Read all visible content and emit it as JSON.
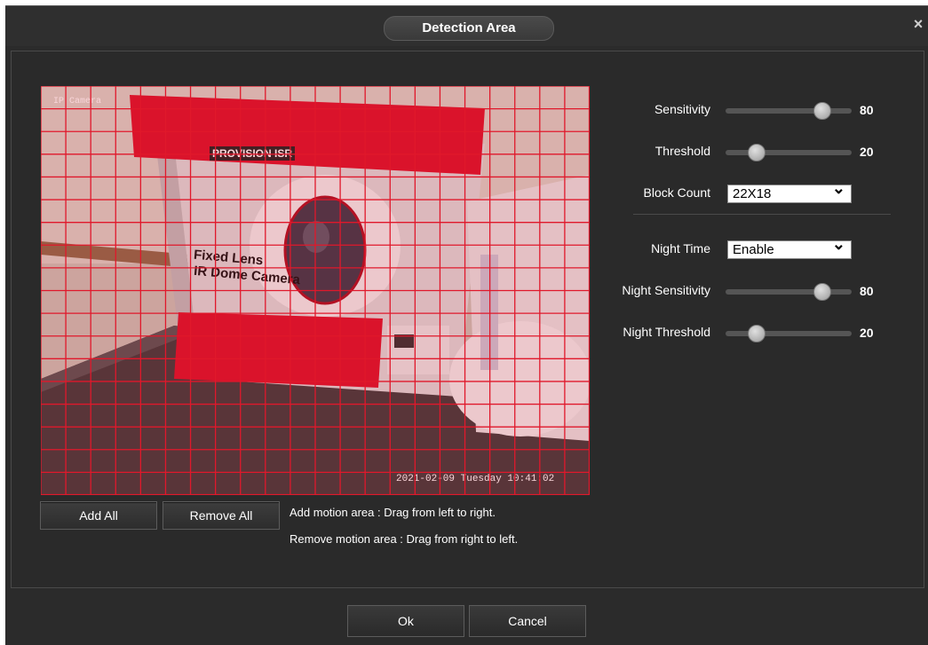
{
  "dialog": {
    "title": "Detection Area",
    "close_glyph": "×"
  },
  "preview": {
    "osd_camera_name": "IP Camera",
    "osd_timestamp": "2021-02-09 Tuesday 10:41:02",
    "box_text_1": "Fixed Lens",
    "box_text_2": "IR Dome Camera",
    "brand_text": "PROVISION ISR",
    "grid": {
      "columns": 22,
      "rows": 18,
      "color": "#e0182b"
    }
  },
  "buttons": {
    "add_all": "Add All",
    "remove_all": "Remove All"
  },
  "help": {
    "add": "Add motion area : Drag from left to right.",
    "remove": "Remove motion area : Drag from right to left."
  },
  "settings": {
    "sensitivity": {
      "label": "Sensitivity",
      "value": "80",
      "level": 80
    },
    "threshold": {
      "label": "Threshold",
      "value": "20",
      "level": 20
    },
    "block_count": {
      "label": "Block Count",
      "selected": "22X18"
    },
    "night_time": {
      "label": "Night Time",
      "selected": "Enable"
    },
    "night_sensitivity": {
      "label": "Night Sensitivity",
      "value": "80",
      "level": 80
    },
    "night_threshold": {
      "label": "Night Threshold",
      "value": "20",
      "level": 20
    }
  },
  "footer": {
    "ok": "Ok",
    "cancel": "Cancel"
  }
}
